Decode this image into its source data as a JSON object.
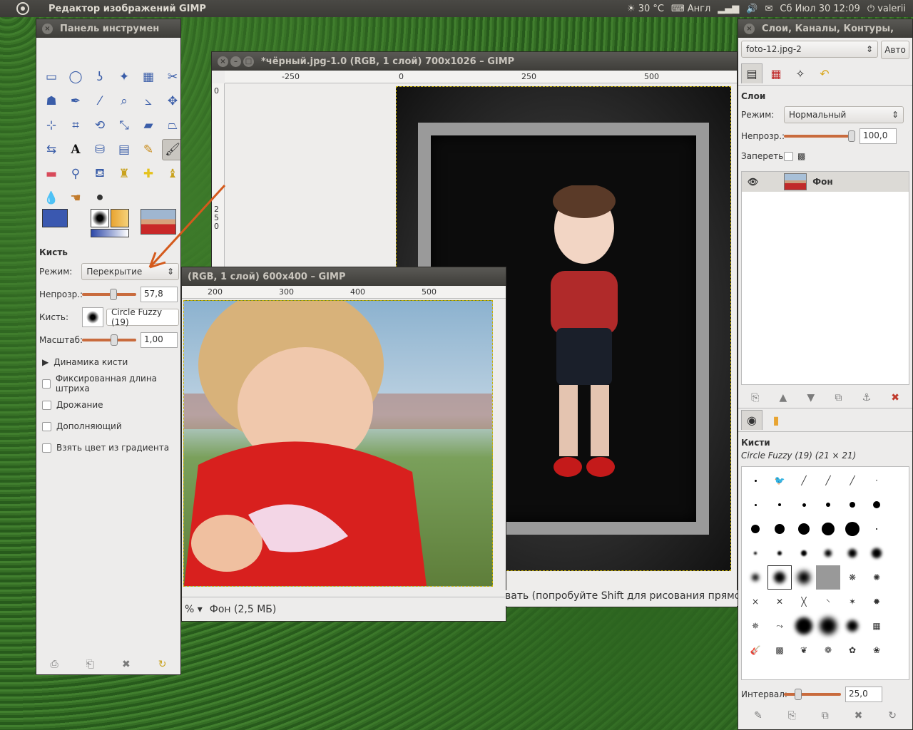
{
  "top_panel": {
    "app_title": "Редактор изображений GIMP",
    "weather": "30 °C",
    "keyboard": "Англ",
    "datetime": "Сб Июл 30 12:09",
    "user": "valerii"
  },
  "toolbox": {
    "title": "Панель инструмен",
    "tool_icons": [
      "rect-select-icon",
      "ellipse-select-icon",
      "free-select-icon",
      "fuzzy-select-icon",
      "select-by-color-icon",
      "scissors-icon",
      "foreground-select-icon",
      "paths-icon",
      "color-picker-icon",
      "zoom-icon",
      "measure-icon",
      "move-icon",
      "align-icon",
      "crop-icon",
      "rotate-icon",
      "scale-icon",
      "shear-icon",
      "perspective-icon",
      "flip-icon",
      "text-icon",
      "bucket-fill-icon",
      "blend-icon",
      "pencil-icon",
      "paintbrush-icon",
      "eraser-icon",
      "airbrush-icon",
      "ink-icon",
      "clone-icon",
      "heal-icon",
      "perspective-clone-icon",
      "blur-icon",
      "smudge-icon",
      "dodge-icon"
    ],
    "options": {
      "header": "Кисть",
      "mode_label": "Режим:",
      "mode_value": "Перекрытие",
      "opacity_label": "Непрозр.:",
      "opacity_value": "57,8",
      "opacity": 57.8,
      "brush_label": "Кисть:",
      "brush_value": "Circle Fuzzy (19)",
      "scale_label": "Масштаб:",
      "scale_value": "1,00",
      "dynamics_label": "Динамика кисти",
      "checks": [
        "Фиксированная длина штриха",
        "Дрожание",
        "Дополняющий",
        "Взять цвет из градиента"
      ]
    },
    "colors": {
      "foreground": "#3a58b0",
      "background": "#ffffff"
    }
  },
  "black_window": {
    "title": "*чёрный.jpg-1.0 (RGB, 1 слой) 700x1026 – GIMP",
    "ruler_h": [
      "-250",
      "0",
      "250",
      "500"
    ],
    "ruler_v": [
      "0",
      "2",
      "5",
      "0"
    ]
  },
  "photo_window": {
    "title": "(RGB, 1 слой) 600x400 – GIMP",
    "ruler_h": [
      "200",
      "300",
      "400",
      "500"
    ],
    "zoom": "%",
    "status": "Фон (2,5 МБ)"
  },
  "hint_text": "вать (попробуйте Shift для рисования прямой л",
  "dock": {
    "title": "Слои, Каналы, Контуры,",
    "image_combo": "foto-12.jpg-2",
    "auto_button": "Авто",
    "layers": {
      "header": "Слои",
      "mode_label": "Режим:",
      "mode_value": "Нормальный",
      "opacity_label": "Непрозр.:",
      "opacity_value": "100,0",
      "opacity": 100,
      "lock_label": "Запереть:",
      "items": [
        {
          "name": "Фон"
        }
      ]
    },
    "brushes": {
      "header": "Кисти",
      "selected": "Circle Fuzzy (19) (21 × 21)",
      "interval_label": "Интервал:",
      "interval_value": "25,0",
      "interval": 25
    }
  }
}
